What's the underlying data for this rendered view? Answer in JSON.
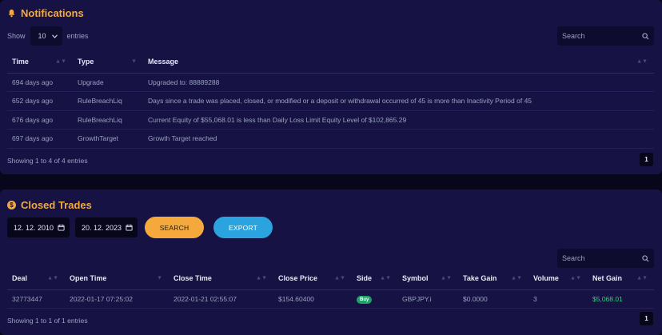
{
  "notifications": {
    "title": "Notifications",
    "show_label": "Show",
    "entries_label": "entries",
    "page_size": "10",
    "search_placeholder": "Search",
    "columns": [
      "Time",
      "Type",
      "Message"
    ],
    "rows": [
      {
        "time": "694 days ago",
        "type": "Upgrade",
        "message": "Upgraded to: 88889288"
      },
      {
        "time": "652 days ago",
        "type": "RuleBreachLiq",
        "message": "Days since a trade was placed, closed, or modified or a deposit or withdrawal occurred of 45 is more than Inactivity Period of 45"
      },
      {
        "time": "676 days ago",
        "type": "RuleBreachLiq",
        "message": "Current Equity of $55,068.01 is less than Daily Loss Limit Equity Level of $102,865.29"
      },
      {
        "time": "697 days ago",
        "type": "GrowthTarget",
        "message": "Growth Target reached"
      }
    ],
    "info": "Showing 1 to 4 of 4 entries",
    "page": "1"
  },
  "trades": {
    "title": "Closed Trades",
    "date_from": "12. 12. 2010",
    "date_to": "20. 12. 2023",
    "search_button": "SEARCH",
    "export_button": "EXPORT",
    "search_placeholder": "Search",
    "columns": [
      "Deal",
      "Open Time",
      "Close Time",
      "Close Price",
      "Side",
      "Symbol",
      "Take Gain",
      "Volume",
      "Net Gain"
    ],
    "rows": [
      {
        "deal": "32773447",
        "open_time": "2022-01-17 07:25:02",
        "close_time": "2022-01-21 02:55:07",
        "close_price": "$154.60400",
        "side": "Buy",
        "symbol": "GBPJPY.i",
        "take_gain": "$0.0000",
        "volume": "3",
        "net_gain": "$5,068.01"
      }
    ],
    "info": "Showing 1 to 1 of 1 entries",
    "page": "1"
  },
  "colors": {
    "accent": "#f5a93c",
    "export": "#2aa3de",
    "gain": "#2fcf7a",
    "panel": "#161344",
    "background": "#07061a"
  },
  "icons": {
    "notifications": "bell-icon",
    "trades": "dollar-coin-icon",
    "search": "magnifier-icon",
    "calendar": "calendar-icon",
    "dropdown": "chevron-down-icon",
    "sort": "sort-arrows-icon"
  }
}
